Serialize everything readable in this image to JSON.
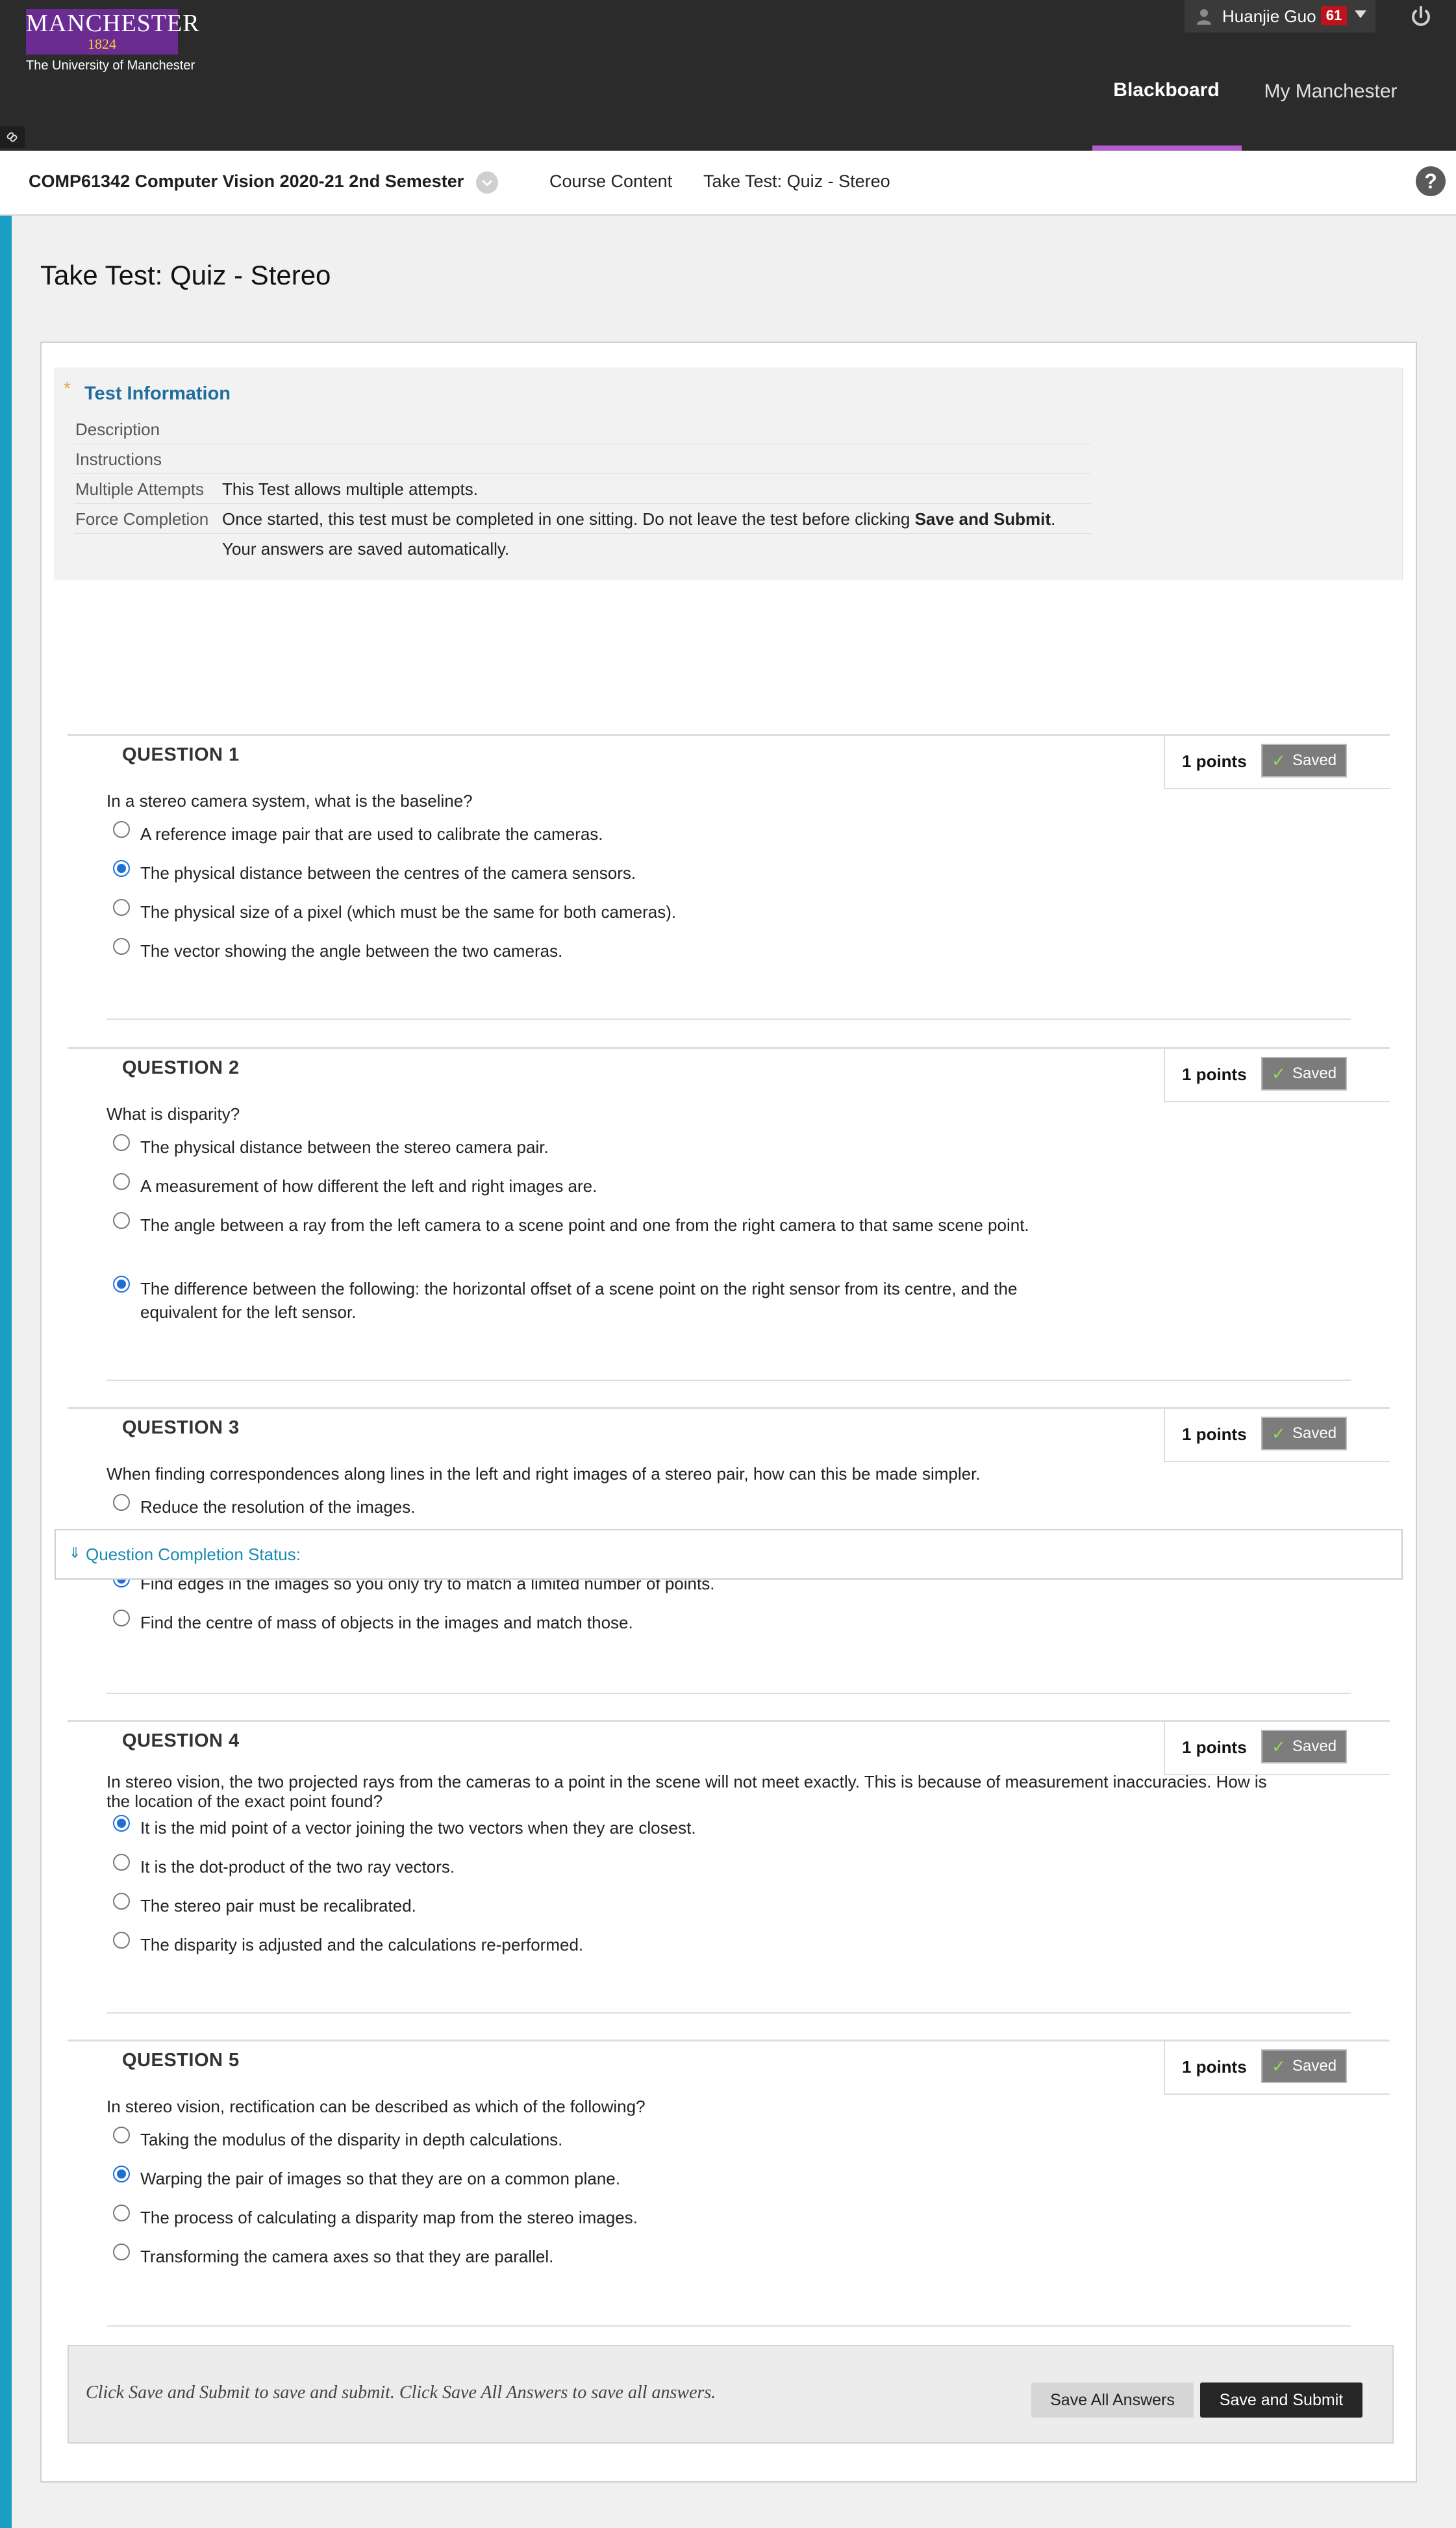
{
  "header": {
    "logo_line1": "MANCHESTER",
    "logo_line2": "1824",
    "logo_subtitle": "The University of Manchester",
    "user_name": "Huanjie Guo",
    "notification_count": "61",
    "tabs": [
      {
        "label": "Blackboard",
        "active": true
      },
      {
        "label": "My Manchester",
        "active": false
      }
    ],
    "active_tab_color": "#b35ccd"
  },
  "breadcrumb": {
    "course": "COMP61342 Computer Vision 2020-21 2nd Semester",
    "items": [
      "Course Content",
      "Take Test: Quiz - Stereo"
    ],
    "help_label": "?"
  },
  "page": {
    "title": "Take Test: Quiz - Stereo",
    "accent_color": "#1a9fc3"
  },
  "test_info": {
    "heading": "Test Information",
    "rows": [
      {
        "label": "Description",
        "value": ""
      },
      {
        "label": "Instructions",
        "value": ""
      },
      {
        "label": "Multiple Attempts",
        "value": "This Test allows multiple attempts."
      },
      {
        "label": "Force Completion",
        "value": "Once started, this test must be completed in one sitting. Do not leave the test before clicking ",
        "value_bold": "Save and Submit",
        "value_end": "."
      }
    ],
    "extra": "Your answers are saved automatically."
  },
  "questions": [
    {
      "title": "QUESTION 1",
      "points": "1 points",
      "saved": "Saved",
      "text": "In a stereo camera system, what is the baseline?",
      "options": [
        {
          "label": "A reference image pair that are used to calibrate the cameras.",
          "selected": false
        },
        {
          "label": "The physical distance between the centres of the camera sensors.",
          "selected": true
        },
        {
          "label": "The physical size of a pixel (which must be the same for both cameras).",
          "selected": false
        },
        {
          "label": "The vector showing the angle between the two cameras.",
          "selected": false
        }
      ]
    },
    {
      "title": "QUESTION 2",
      "points": "1 points",
      "saved": "Saved",
      "text": "What is disparity?",
      "options": [
        {
          "label": "The physical distance between the stereo camera pair.",
          "selected": false
        },
        {
          "label": "A measurement of how different the left and right images are.",
          "selected": false
        },
        {
          "label": "The angle between a ray from the left camera to a scene point and one from the right camera to that same scene point.",
          "selected": false
        },
        {
          "label": "The difference between the following: the horizontal offset of a scene point on the right sensor from its centre, and the equivalent for the left sensor.",
          "selected": true
        }
      ]
    },
    {
      "title": "QUESTION 3",
      "points": "1 points",
      "saved": "Saved",
      "text": "When finding correspondences along lines in the left and right images of a stereo pair, how can this be made simpler.",
      "options": [
        {
          "label": "Reduce the resolution of the images.",
          "selected": false
        },
        {
          "label": "Find edges in the images so you only try to match a limited number of points.",
          "selected": true
        },
        {
          "label": "Find the centre of mass of objects in the images and match those.",
          "selected": false
        }
      ]
    },
    {
      "title": "QUESTION 4",
      "points": "1 points",
      "saved": "Saved",
      "text": "In stereo vision, the two projected rays from the cameras to a point in the scene will not meet exactly.  This is because of measurement inaccuracies.  How is the location of the exact point found?",
      "options": [
        {
          "label": "It is the mid point of a vector joining the two vectors when they are closest.",
          "selected": true
        },
        {
          "label": "It is the dot-product of the two ray vectors.",
          "selected": false
        },
        {
          "label": "The stereo pair must be recalibrated.",
          "selected": false
        },
        {
          "label": "The disparity is adjusted and the calculations re-performed.",
          "selected": false
        }
      ]
    },
    {
      "title": "QUESTION 5",
      "points": "1 points",
      "saved": "Saved",
      "text": "In stereo vision, rectification can be described as which of the following?",
      "options": [
        {
          "label": "Taking the modulus of the disparity in depth calculations.",
          "selected": false
        },
        {
          "label": "Warping the pair of images so that they are on a common plane.",
          "selected": true
        },
        {
          "label": "The process of calculating a disparity map from the stereo images.",
          "selected": false
        },
        {
          "label": "Transforming the camera axes so that they are parallel.",
          "selected": false
        }
      ]
    }
  ],
  "completion_status": {
    "label": "Question Completion Status:"
  },
  "footer": {
    "message": "Click Save and Submit to save and submit. Click Save All Answers to save all answers.",
    "save_all_label": "Save All Answers",
    "submit_label": "Save and Submit"
  }
}
